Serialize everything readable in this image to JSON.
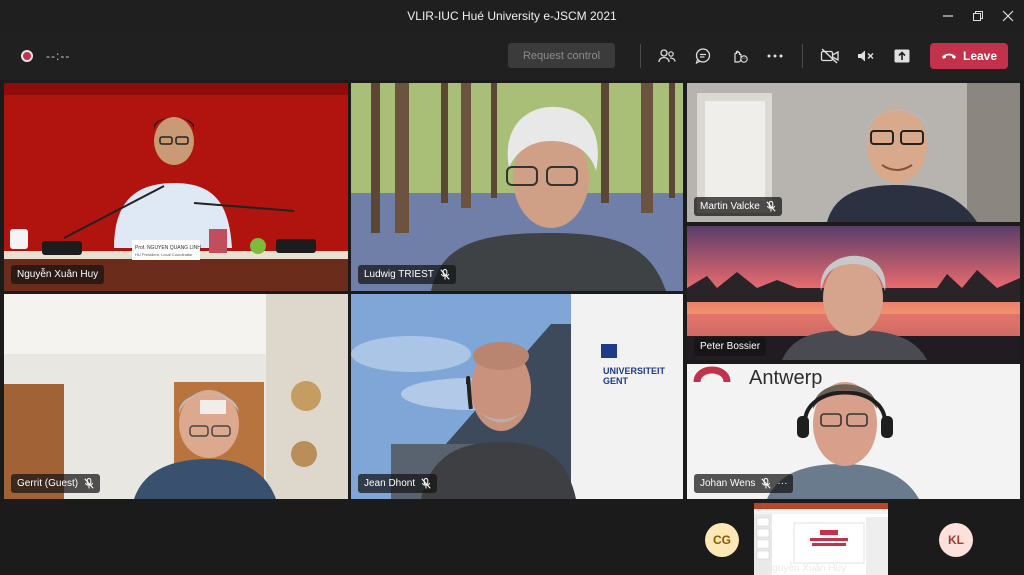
{
  "window": {
    "title": "VLIR-IUC Hué University e-JSCM 2021",
    "minimize_icon": "minimize-icon",
    "restore_icon": "restore-icon",
    "close_icon": "close-icon"
  },
  "toolbar": {
    "recording_timer": "--:--",
    "request_control_label": "Request control",
    "leave_label": "Leave",
    "icons": [
      "participants-icon",
      "chat-icon",
      "reactions-icon",
      "more-options-icon",
      "camera-off-icon",
      "speaker-mute-icon",
      "share-tray-icon",
      "phone-icon"
    ]
  },
  "participants": [
    {
      "name": "Nguyễn Xuân Huy",
      "muted": false
    },
    {
      "name": "Ludwig TRIEST",
      "muted": true
    },
    {
      "name": "Martin Valcke",
      "muted": true
    },
    {
      "name": "Peter Bossier",
      "muted": false
    },
    {
      "name": "Gerrit (Guest)",
      "muted": true
    },
    {
      "name": "Jean Dhont",
      "muted": true
    },
    {
      "name": "Johan Wens",
      "muted": true,
      "more": "···"
    }
  ],
  "video_text": {
    "desk_nameplate": "Prof. NGUYEN QUANG LINH",
    "desk_nameplate_sub": "HU President, Local Coordinator",
    "building_sign_line1": "UNIVERSITEIT",
    "building_sign_line2": "GENT",
    "banner_text": "Antwerp"
  },
  "bottom_strip": {
    "avatar_left": "CG",
    "avatar_right": "KL",
    "screen_share_label": "Nguyễn Xuân Huy"
  },
  "colors": {
    "leave": "#c4314b",
    "avatar_cg_bg": "#fce7b6",
    "avatar_cg_fg": "#8a5a00",
    "avatar_kl_bg": "#fde0dc",
    "avatar_kl_fg": "#a33a2e"
  }
}
